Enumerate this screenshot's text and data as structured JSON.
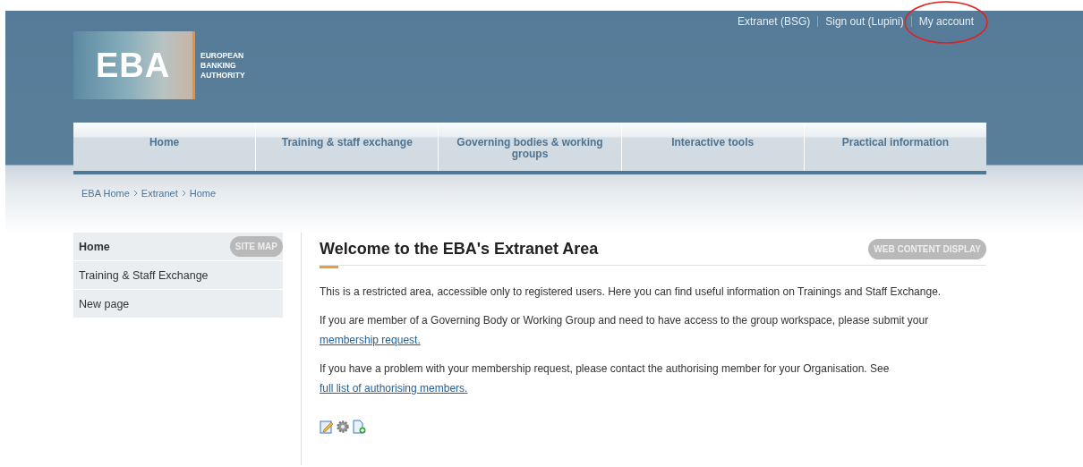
{
  "logo": {
    "mark": "EBA",
    "name_lines": [
      "EUROPEAN",
      "BANKING",
      "AUTHORITY"
    ]
  },
  "top_links": [
    {
      "label": "Extranet (BSG)",
      "circled": false
    },
    {
      "label": "Sign out (Lupini)",
      "circled": false
    },
    {
      "label": "My account",
      "circled": true
    }
  ],
  "nav": [
    {
      "label": "Home"
    },
    {
      "label": "Training & staff exchange"
    },
    {
      "label": "Governing bodies & working groups"
    },
    {
      "label": "Interactive tools"
    },
    {
      "label": "Practical information"
    }
  ],
  "breadcrumb": [
    "EBA Home",
    "Extranet",
    "Home"
  ],
  "sidebar": {
    "badge": "SITE MAP",
    "items": [
      {
        "label": "Home",
        "selected": true
      },
      {
        "label": "Training & Staff Exchange",
        "selected": false
      },
      {
        "label": "New page",
        "selected": false
      }
    ]
  },
  "main": {
    "title": "Welcome to the EBA's Extranet Area",
    "badge": "WEB CONTENT DISPLAY",
    "paragraphs": [
      {
        "text": "This is a restricted area, accessible only to registered users. Here you can find useful  information on Trainings and Staff Exchange."
      },
      {
        "text": "If you are member of a Governing Body or Working Group and need to have access to the group workspace, please submit your",
        "link": "membership request."
      },
      {
        "text": "If you have a problem with your membership request, please contact the authorising member for your Organisation. See",
        "link": "full list of authorising members."
      }
    ]
  }
}
